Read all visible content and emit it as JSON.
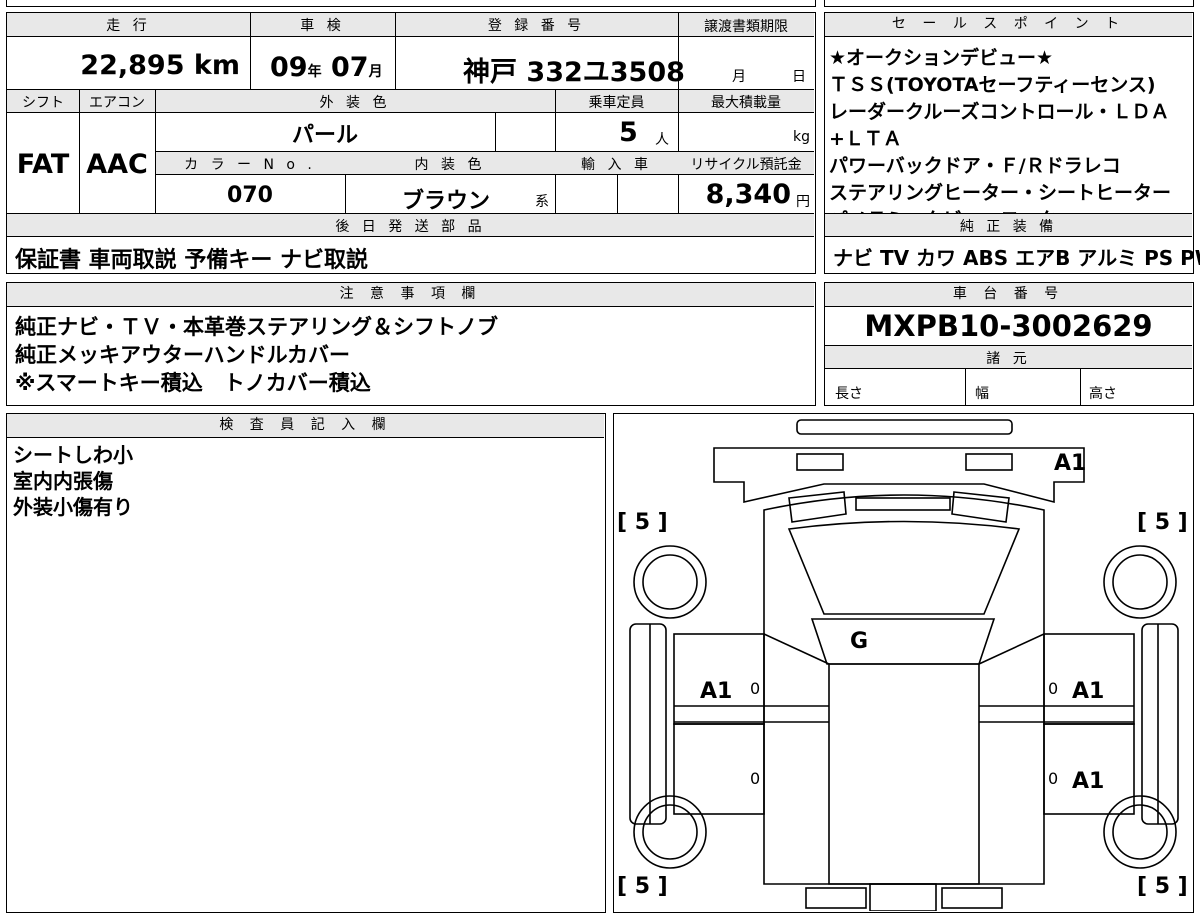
{
  "vehicle": {
    "header": {
      "mileage": "走 行",
      "inspection": "車 検",
      "registration": "登 録 番 号",
      "transfer_deadline": "譲渡書類期限"
    },
    "mileage": "22,895",
    "mileage_unit": "km",
    "inspection_year": "09",
    "year_unit": "年",
    "inspection_month": "07",
    "month_unit": "月",
    "registration_region": "神戸",
    "registration_number": "332ユ3508",
    "deadline_month_unit": "月",
    "deadline_day_unit": "日"
  },
  "specs": {
    "header": {
      "shift": "シフト",
      "aircon": "エアコン",
      "exterior_color": "外 装 色",
      "capacity": "乗車定員",
      "max_load": "最大積載量",
      "color_no": "カ ラ ー N o .",
      "interior_color": "内 装 色",
      "import": "輸 入 車",
      "recycle": "リサイクル預託金"
    },
    "shift": "FAT",
    "aircon": "AAC",
    "exterior_color": "パール",
    "capacity": "5",
    "capacity_unit": "人",
    "max_load_unit": "kg",
    "color_no": "070",
    "interior_color": "ブラウン",
    "interior_suffix": "系",
    "recycle_fee": "8,340",
    "recycle_unit": "円"
  },
  "later_parts": {
    "header": "後 日 発 送 部 品",
    "items": "保証書 車両取説 予備キー ナビ取説"
  },
  "sales_points": {
    "header": "セ ー ル ス ポ イ ン ト",
    "lines": [
      "★オークションデビュー★",
      "ＴＳＳ(TOYOTAセーフティーセンス)",
      "レーダークルーズコントロール・ＬＤＡ+ＬＴＡ",
      "パワーバックドア・Ｆ/Ｒドラレコ",
      "ステアリングヒーター・シートヒーター",
      "パノラミックビューモニター"
    ]
  },
  "equipment": {
    "header": "純 正 装 備",
    "items": "ナビ TV カワ ABS エアB アルミ PS PW"
  },
  "notes": {
    "header": "注 意 事 項 欄",
    "lines": [
      "純正ナビ・ＴＶ・本革巻ステアリング＆シフトノブ",
      "純正メッキアウターハンドルカバー",
      "※スマートキー積込　トノカバー積込"
    ]
  },
  "chassis": {
    "header": "車 台 番 号",
    "number": "MXPB10-3002629",
    "dims_header": "諸 元",
    "length": "長さ",
    "width": "幅",
    "height": "高さ"
  },
  "inspector": {
    "header": "検 査 員 記 入 欄",
    "lines": [
      "シートしわ小",
      "室内内張傷",
      "外装小傷有り"
    ]
  },
  "diagram": {
    "tire_fl": "[ 5 ]",
    "tire_fr": "[ 5 ]",
    "tire_rl": "[ 5 ]",
    "tire_rr": "[ 5 ]",
    "mark_top": "A1",
    "mark_glass": "G",
    "mark_left_door": "A1",
    "mark_right_front": "A1",
    "mark_right_rear": "A1",
    "zero_lf": "0",
    "zero_rf": "0",
    "zero_lr": "0",
    "zero_rr": "0"
  }
}
